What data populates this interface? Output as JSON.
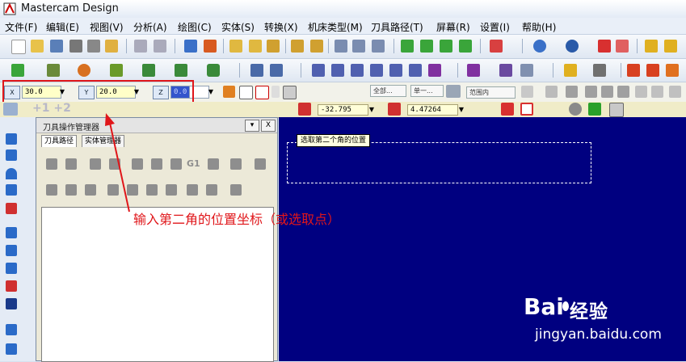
{
  "app": {
    "title": "Mastercam Design"
  },
  "menu": [
    "文件(F)",
    "编辑(E)",
    "视图(V)",
    "分析(A)",
    "绘图(C)",
    "实体(S)",
    "转换(X)",
    "机床类型(M)",
    "刀具路径(T)",
    "屏幕(R)",
    "设置(I)",
    "帮助(H)"
  ],
  "coords": {
    "x_value": "30.0",
    "y_value": "20.0",
    "z_value": "0.0",
    "x_label": "X",
    "y_label": "Y",
    "z_label": "Z"
  },
  "combos": {
    "c1": "全部...",
    "c2": "单一...",
    "c3": "范围内"
  },
  "ribbon": {
    "step_label": "+1 +2",
    "field1": "-32.795",
    "field2": "4.47264"
  },
  "panel": {
    "title": "刀具操作管理器",
    "tab1": "刀具路径",
    "tab2": "实体管理器",
    "g1_label": "G1",
    "close_label": "X"
  },
  "viewport": {
    "tooltip": "选取第二个角的位置",
    "bg_color": "#000080"
  },
  "annotation": {
    "text": "输入第二角的位置坐标（或选取点）",
    "color": "#e0161a"
  },
  "watermark": {
    "brand": "Bai",
    "brand_suffix": "经验",
    "url": "jingyan.baidu.com"
  }
}
